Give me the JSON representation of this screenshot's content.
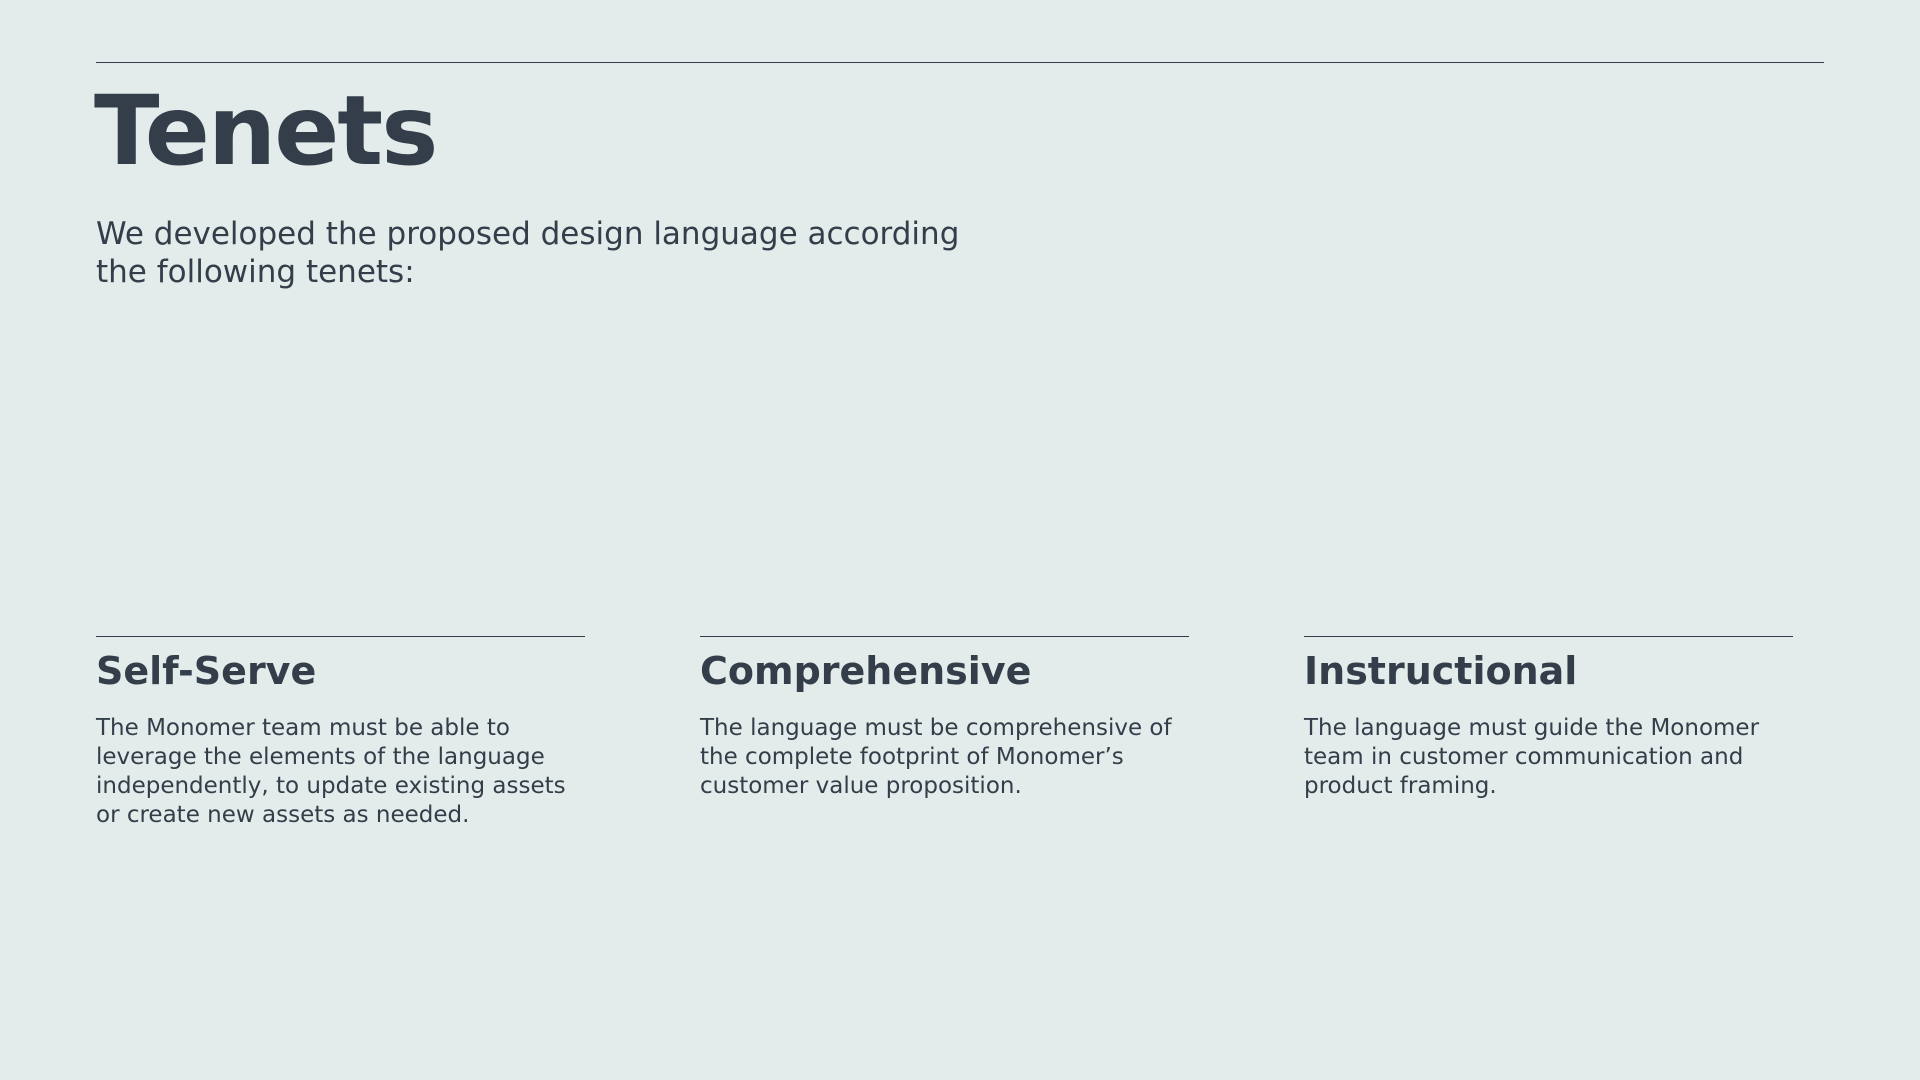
{
  "page": {
    "title": "Tenets",
    "intro_line1": "We developed the proposed design language according",
    "intro_line2": "the following tenets:"
  },
  "tenets": [
    {
      "title": "Self-Serve",
      "body_lines": [
        "The Monomer team must be able to",
        "leverage the elements of the language",
        "independently, to update existing assets",
        "or create new assets as needed."
      ]
    },
    {
      "title": "Comprehensive",
      "body_lines": [
        "The language must be comprehensive of",
        "the complete footprint of Monomer’s",
        "customer value proposition."
      ]
    },
    {
      "title": "Instructional",
      "body_lines": [
        "The language must guide the Monomer",
        "team in customer communication and",
        "product framing."
      ]
    }
  ],
  "colors": {
    "background": "#e3ecea",
    "text": "#333e4a"
  }
}
